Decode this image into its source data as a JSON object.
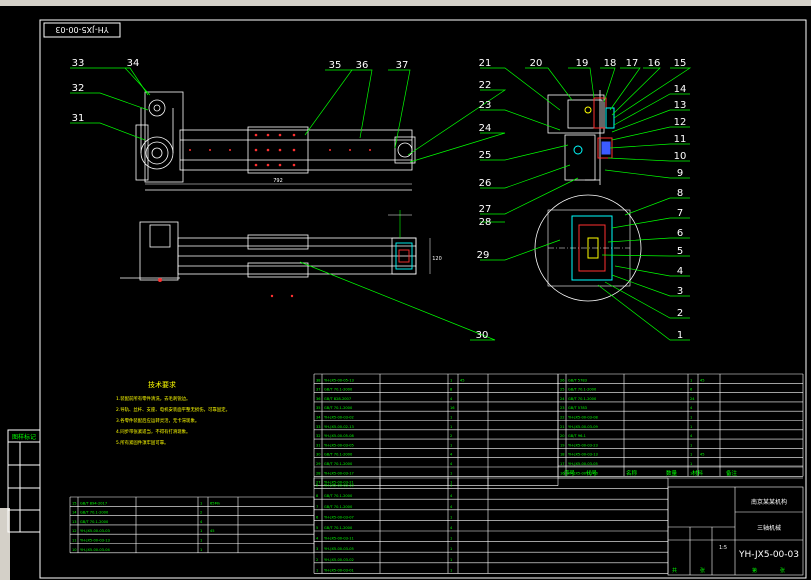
{
  "drawing": {
    "code_top_box": "YH-JX5-00-03",
    "code_bottom": "YH-JX5-00-03",
    "title_name": "三轴机械",
    "company": "南京某某机构",
    "dim_length": "792",
    "dim_small": "120",
    "note_main": "技术要求",
    "note_lines": [
      "1.装配前所有零件清洗，去毛刺锐边。",
      "2.导轨、丝杆、支座、电机安装面平整无损伤，可靠固定。",
      "3.各零件装配后应运转灵活，无卡滞现象。",
      "4.同步带张紧适当，不得有打滑现象。",
      "5.所有紧固件须牢固可靠。"
    ],
    "side_stamp": "图样标记"
  },
  "balloons": [
    "1",
    "2",
    "3",
    "4",
    "5",
    "6",
    "7",
    "8",
    "9",
    "10",
    "11",
    "12",
    "13",
    "14",
    "15",
    "16",
    "17",
    "18",
    "19",
    "20",
    "21",
    "22",
    "23",
    "24",
    "25",
    "26",
    "27",
    "28",
    "29",
    "30",
    "31",
    "32",
    "33",
    "34",
    "35",
    "36",
    "37"
  ],
  "title_block": {
    "headers": [
      "序号",
      "代号",
      "名称",
      "数量",
      "材料",
      "备注"
    ],
    "sheet_info": [
      "共",
      "张",
      "第",
      "张"
    ],
    "scale": "1:5",
    "rows_left": [
      [
        "38",
        "YH-JX5-00-05-13",
        "",
        "1",
        "45",
        ""
      ],
      [
        "37",
        "GB/T 70.1-2000",
        "",
        "8",
        "",
        ""
      ],
      [
        "36",
        "GB/T 828-2007",
        "",
        "4",
        "",
        ""
      ],
      [
        "35",
        "GB/T 70.1-2000",
        "",
        "16",
        "",
        ""
      ],
      [
        "34",
        "YH-JX5-00-03-02",
        "",
        "1",
        "",
        ""
      ],
      [
        "33",
        "YH-JX5-00-02-13",
        "",
        "1",
        "",
        ""
      ],
      [
        "32",
        "YH-JX5-00-05-08",
        "",
        "2",
        "",
        ""
      ],
      [
        "31",
        "YH-JX5-00-03-05",
        "",
        "1",
        "",
        ""
      ],
      [
        "30",
        "GB/T 70.1-2000",
        "",
        "4",
        "",
        ""
      ],
      [
        "29",
        "GB/T 70.1-2000",
        "",
        "4",
        "",
        ""
      ],
      [
        "28",
        "YH-JX5-00-03-17",
        "",
        "1",
        "",
        ""
      ],
      [
        "27",
        "YH-JX5-00-03-21",
        "",
        "1",
        "",
        ""
      ]
    ],
    "rows_right": [
      [
        "26",
        "GB/T 5783",
        "",
        "1",
        "45",
        ""
      ],
      [
        "25",
        "GB/T 70.1-2000",
        "",
        "6",
        "",
        ""
      ],
      [
        "24",
        "GB/T 70.1-2000",
        "",
        "24",
        "",
        ""
      ],
      [
        "23",
        "GB/T 5783",
        "",
        "4",
        "",
        ""
      ],
      [
        "22",
        "YH-JX5-00-03-08",
        "",
        "1",
        "",
        ""
      ],
      [
        "21",
        "YH-JX5-00-03-09",
        "",
        "1",
        "",
        ""
      ],
      [
        "20",
        "GB/T 96-1",
        "",
        "4",
        "",
        ""
      ],
      [
        "19",
        "YH-JX5-00-03-23",
        "",
        "1",
        "",
        ""
      ],
      [
        "18",
        "YH-JX5-00-03-13",
        "",
        "1",
        "45",
        ""
      ],
      [
        "17",
        "YH-JX5-00-03-05",
        "",
        "1",
        "",
        ""
      ],
      [
        "16",
        "YH-JX5-00-03-03",
        "",
        "1",
        "",
        ""
      ]
    ],
    "rows_bottom": [
      [
        "15",
        "GB/T 894-2017",
        "",
        "1",
        "65Mn",
        ""
      ],
      [
        "14",
        "GB/T 70.1-2000",
        "",
        "2",
        "",
        ""
      ],
      [
        "13",
        "GB/T 70.1-2000",
        "",
        "4",
        "",
        ""
      ],
      [
        "12",
        "YH-JX5-00-03-03",
        "",
        "1",
        "45",
        ""
      ],
      [
        "11",
        "YH-JX5-00-03-13",
        "",
        "1",
        "",
        ""
      ],
      [
        "10",
        "YH-JX5-00-03-04",
        "",
        "1",
        "",
        ""
      ]
    ],
    "rows_bottom2": [
      [
        "9",
        "YH-JX5-00-03-10",
        "",
        "1",
        "",
        ""
      ],
      [
        "8",
        "GB/T 70.1-2000",
        "",
        "4",
        "",
        ""
      ],
      [
        "7",
        "GB/T 70.1-2000",
        "",
        "4",
        "",
        ""
      ],
      [
        "6",
        "YH-JX5-00-03-07",
        "",
        "1",
        "",
        ""
      ],
      [
        "5",
        "GB/T 70.1-2000",
        "",
        "4",
        "",
        ""
      ],
      [
        "4",
        "YH-JX5-00-03-11",
        "",
        "1",
        "",
        ""
      ],
      [
        "3",
        "YH-JX5-00-03-05",
        "",
        "1",
        "",
        ""
      ],
      [
        "2",
        "YH-JX5-00-03-02",
        "",
        "1",
        "",
        ""
      ],
      [
        "1",
        "YH-JX5-00-03-01",
        "",
        "1",
        "",
        ""
      ]
    ]
  },
  "colors": {
    "background": "#000000",
    "frame": "#ffffff",
    "geometry": "#ffffff",
    "leader": "#00ff00",
    "balloon_text": "#ffffff",
    "table_text": "#00ff00",
    "note_text": "#ffff00",
    "accent_red": "#ff0000",
    "accent_cyan": "#00ffff",
    "accent_blue": "#3b5bff",
    "title_magenta": "#ffffff"
  }
}
